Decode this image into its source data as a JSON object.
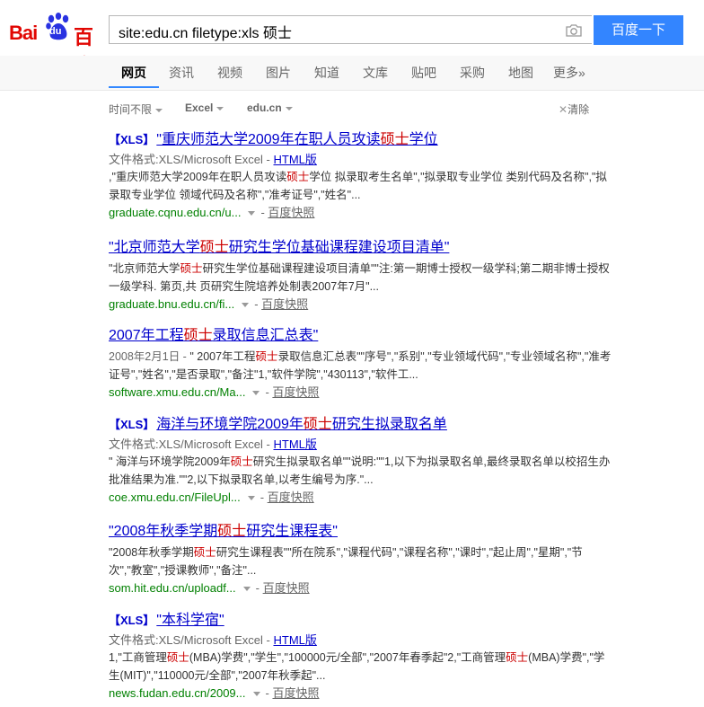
{
  "header": {
    "logo_left": "Bai",
    "logo_paw_text": "du",
    "logo_right": "百度",
    "search_value": "site:edu.cn filetype:xls 硕士",
    "search_button": "百度一下",
    "camera_icon": "camera-icon"
  },
  "nav": {
    "tabs": [
      {
        "label": "网页",
        "active": true
      },
      {
        "label": "资讯"
      },
      {
        "label": "视频"
      },
      {
        "label": "图片"
      },
      {
        "label": "知道"
      },
      {
        "label": "文库"
      },
      {
        "label": "贴吧"
      },
      {
        "label": "采购"
      },
      {
        "label": "地图"
      },
      {
        "label": "更多»"
      }
    ]
  },
  "filters": {
    "time": "时间不限",
    "type": "Excel",
    "site": "edu.cn",
    "clear": "清除"
  },
  "results": [
    {
      "tag": "【XLS】",
      "title_pre": "\"重庆师范大学2009年在职人员攻读",
      "title_hl": "硕士",
      "title_post": "学位",
      "format_label": "文件格式:XLS/Microsoft Excel - ",
      "format_link": "HTML版",
      "abs_pre": ",\"重庆师范大学2009年在职人员攻读",
      "abs_hl": "硕士",
      "abs_post": "学位 拟录取考生名单\",\"拟录取专业学位 类别代码及名称\",\"拟录取专业学位 领域代码及名称\",\"准考证号\",\"姓名\"...",
      "url": "graduate.cqnu.edu.cn/u...",
      "sep": "- ",
      "snapshot": "百度快照"
    },
    {
      "tag": "",
      "title_pre": "\"北京师范大学",
      "title_hl": "硕士",
      "title_post": "研究生学位基础课程建设项目清单\"",
      "abs_pre": "\"北京师范大学",
      "abs_hl": "硕士",
      "abs_post": "研究生学位基础课程建设项目清单\"\"注:第一期博士授权一级学科;第二期非博士授权一级学科. 第页,共 页研究生院培养处制表2007年7月\"...",
      "url": "graduate.bnu.edu.cn/fi...",
      "sep": "- ",
      "snapshot": "百度快照"
    },
    {
      "tag": "",
      "title_pre": "2007年工程",
      "title_hl": "硕士",
      "title_post": "录取信息汇总表\"",
      "abs_date": "2008年2月1日 - ",
      "abs_pre": "\" 2007年工程",
      "abs_hl": "硕士",
      "abs_post": "录取信息汇总表\"\"序号\",\"系别\",\"专业领域代码\",\"专业领域名称\",\"准考证号\",\"姓名\",\"是否录取\",\"备注\"1,\"软件学院\",\"430113\",\"软件工...",
      "url": "software.xmu.edu.cn/Ma...",
      "sep": "- ",
      "snapshot": "百度快照"
    },
    {
      "tag": "【XLS】",
      "title_pre": "海洋与环境学院2009年",
      "title_hl": "硕士",
      "title_post": "研究生拟录取名单",
      "format_label": "文件格式:XLS/Microsoft Excel - ",
      "format_link": "HTML版",
      "abs_pre": "\" 海洋与环境学院2009年",
      "abs_hl": "硕士",
      "abs_post": "研究生拟录取名单\"\"说明:\"\"1,以下为拟录取名单,最终录取名单以校招生办批准结果为准.\"\"2,以下拟录取名单,以考生编号为序.\"...",
      "url": "coe.xmu.edu.cn/FileUpl...",
      "sep": "- ",
      "snapshot": "百度快照"
    },
    {
      "tag": "",
      "title_pre": "\"2008年秋季学期",
      "title_hl": "硕士",
      "title_post": "研究生课程表\"",
      "abs_pre": "\"2008年秋季学期",
      "abs_hl": "硕士",
      "abs_post": "研究生课程表\"\"所在院系\",\"课程代码\",\"课程名称\",\"课时\",\"起止周\",\"星期\",\"节次\",\"教室\",\"授课教师\",\"备注\"...",
      "url": "som.hit.edu.cn/uploadf...",
      "sep": "- ",
      "snapshot": "百度快照"
    },
    {
      "tag": "【XLS】",
      "title_pre": "\"本科学宿\"",
      "title_hl": "",
      "title_post": "",
      "format_label": "文件格式:XLS/Microsoft Excel - ",
      "format_link": "HTML版",
      "abs_pre": "1,\"工商管理",
      "abs_hl": "硕士",
      "abs_mid": "(MBA)学费\",\"学生\",\"100000元/全部\",\"2007年春季起\"2,\"工商管理",
      "abs_hl2": "硕士",
      "abs_post": "(MBA)学费\",\"学生(MIT)\",\"110000元/全部\",\"2007年秋季起\"...",
      "url": "news.fudan.edu.cn/2009...",
      "sep": "- ",
      "snapshot": "百度快照"
    }
  ]
}
